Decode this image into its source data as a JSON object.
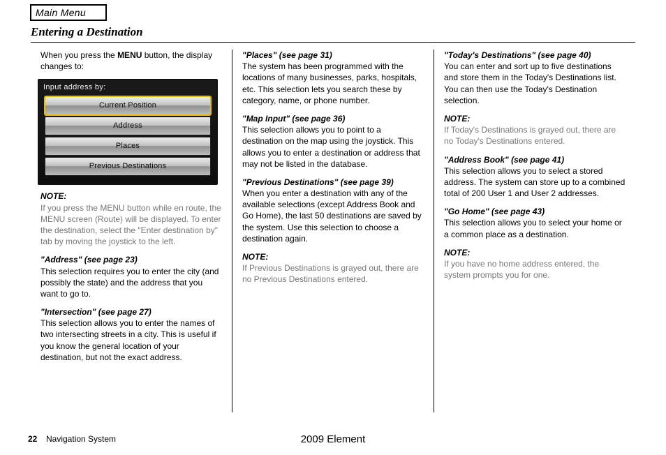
{
  "side_label": "Main Menu",
  "page_title": "Entering a Destination",
  "footer": "2009  Element",
  "page_number_bold": "22",
  "page_number_label": "Navigation System",
  "columns": {
    "left": {
      "h1": "Entering a Destination",
      "p1_a": "When you press the ",
      "p1_b": "MENU",
      "p1_c": " button, the display changes to:",
      "screen": {
        "title": "Input address by:",
        "buttons": [
          "Current Position",
          "Address",
          "Places",
          "Previous Destinations"
        ]
      },
      "note_label": "NOTE:",
      "note_text": "If you press the MENU button while en route, the MENU screen (Route) will be displayed. To enter the destination, select the \"Enter destination by\" tab by moving the joystick to the left.",
      "p2": "\"Address\" (see page 23)",
      "p2_text": "This selection requires you to enter the city (and possibly the state) and the address that you want to go to.",
      "p3": "\"Intersection\" (see page 27)",
      "p3_text": "This selection allows you to enter the names of two intersecting streets in a city. This is useful if you know the general location of your destination, but not the exact address."
    },
    "mid": {
      "p1": "\"Places\" (see page 31)",
      "p1_text": "The system has been programmed with the locations of many businesses, parks, hospitals, etc. This selection lets you search these by category, name, or phone number.",
      "p2": "\"Map Input\" (see page 36)",
      "p2_text": "This selection allows you to point to a destination on the map using the joystick. This allows you to enter a destination or address that may not be listed in the database.",
      "p3": "\"Previous Destinations\" (see page 39)",
      "p3_text": "When you enter a destination with any of the available selections (except Address Book and Go Home), the last 50 destinations are saved by the system. Use this selection to choose a destination again.",
      "note_label": "NOTE:",
      "note_text": "If Previous Destinations is grayed out, there are no Previous Destinations entered."
    },
    "right": {
      "p1": "\"Today's Destinations\" (see page 40)",
      "p1_text": "You can enter and sort up to five destinations and store them in the Today's Destinations list. You can then use the Today's Destination selection.",
      "note1_label": "NOTE:",
      "note1_text": "If Today's Destinations is grayed out, there are no Today's Destinations entered.",
      "p2": "\"Address Book\" (see page 41)",
      "p2_text": "This selection allows you to select a stored address. The system can store up to a combined total of 200 User 1 and User 2 addresses.",
      "p3": "\"Go Home\" (see page 43)",
      "p3_text": "This selection allows you to select your home or a common place as a destination.",
      "note2_label": "NOTE:",
      "note2_text": "If you have no home address entered, the system prompts you for one."
    }
  }
}
